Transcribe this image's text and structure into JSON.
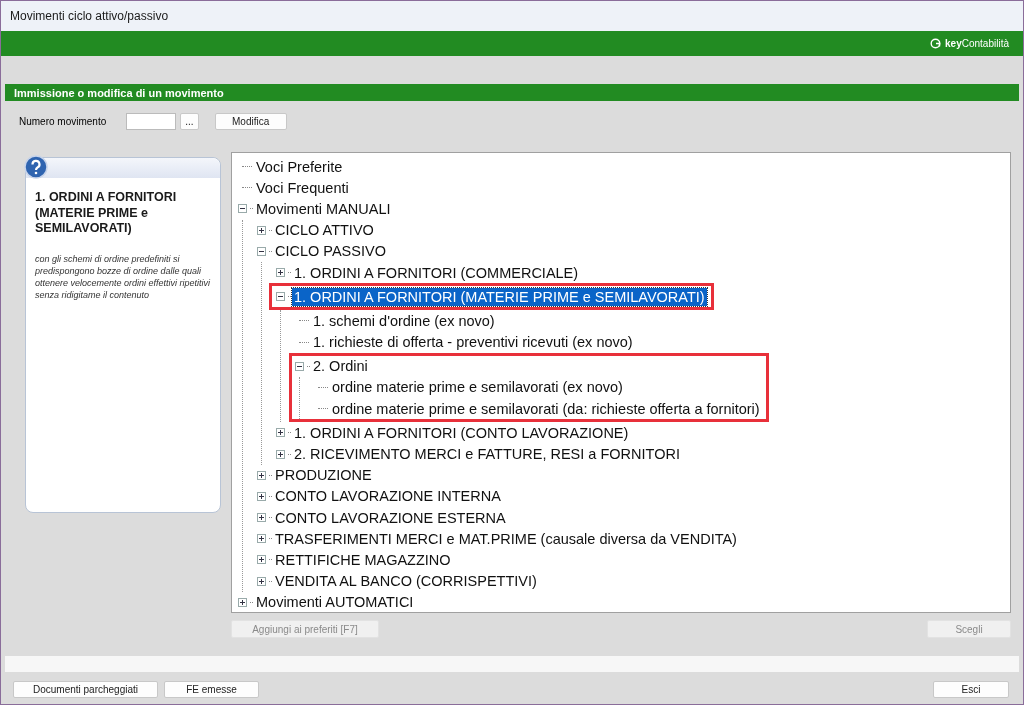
{
  "window": {
    "title": "Movimenti ciclo attivo/passivo"
  },
  "brand": {
    "prefix": "key",
    "name": "Contabilità"
  },
  "section": {
    "title": "Immissione o modifica di un movimento"
  },
  "numero": {
    "label": "Numero movimento",
    "lookup_button": "...",
    "modify_button": "Modifica"
  },
  "help": {
    "title": "1. ORDINI A FORNITORI (MATERIE PRIME e SEMILAVORATI)",
    "description": "con gli schemi di ordine predefiniti si predispongono bozze di ordine dalle quali ottenere velocemente ordini effettivi ripetitivi senza ridigitame il contenuto"
  },
  "tree": [
    {
      "label": "Voci Preferite",
      "selected": false
    },
    {
      "label": "Voci Frequenti",
      "selected": false
    },
    {
      "label": "Movimenti MANUALI",
      "selected": false,
      "expanded": true,
      "children": [
        {
          "label": "CICLO ATTIVO",
          "selected": false,
          "expanded": false
        },
        {
          "label": "CICLO PASSIVO",
          "selected": false,
          "expanded": true,
          "children": [
            {
              "label": "1. ORDINI A FORNITORI (COMMERCIALE)",
              "selected": false,
              "expanded": false
            },
            {
              "label": "1. ORDINI A FORNITORI (MATERIE PRIME e SEMILAVORATI)",
              "selected": true,
              "expanded": true,
              "framed_row": true,
              "children": [
                {
                  "label": "1. schemi d'ordine (ex novo)",
                  "selected": false
                },
                {
                  "label": "1. richieste di offerta - preventivi ricevuti (ex novo)",
                  "selected": false
                },
                {
                  "label": "2. Ordini",
                  "selected": false,
                  "expanded": true,
                  "framed_branch": true,
                  "children": [
                    {
                      "label": "ordine materie prime e semilavorati (ex novo)",
                      "selected": false
                    },
                    {
                      "label": "ordine materie prime e semilavorati (da: richieste offerta a fornitori)",
                      "selected": false
                    }
                  ]
                }
              ]
            },
            {
              "label": "1. ORDINI A FORNITORI (CONTO LAVORAZIONE)",
              "selected": false,
              "expanded": false
            },
            {
              "label": "2. RICEVIMENTO MERCI e FATTURE,  RESI a FORNITORI",
              "selected": false,
              "expanded": false
            }
          ]
        },
        {
          "label": "PRODUZIONE",
          "selected": false,
          "expanded": false
        },
        {
          "label": "CONTO LAVORAZIONE INTERNA",
          "selected": false,
          "expanded": false
        },
        {
          "label": "CONTO LAVORAZIONE ESTERNA",
          "selected": false,
          "expanded": false
        },
        {
          "label": "TRASFERIMENTI MERCI e MAT.PRIME (causale diversa da VENDITA)",
          "selected": false,
          "expanded": false
        },
        {
          "label": "RETTIFICHE MAGAZZINO",
          "selected": false,
          "expanded": false
        },
        {
          "label": "VENDITA AL BANCO (CORRISPETTIVI)",
          "selected": false,
          "expanded": false
        }
      ]
    },
    {
      "label": "Movimenti AUTOMATICI",
      "selected": false,
      "expanded": false
    }
  ],
  "tree_buttons": [
    {
      "label": "Aggiungi ai preferiti [F7]",
      "disabled": true
    },
    {
      "label": "Scegli",
      "disabled": true
    }
  ],
  "footer_buttons": [
    {
      "label": "Documenti parcheggiati"
    },
    {
      "label": "FE emesse"
    },
    {
      "label": "Esci"
    }
  ]
}
